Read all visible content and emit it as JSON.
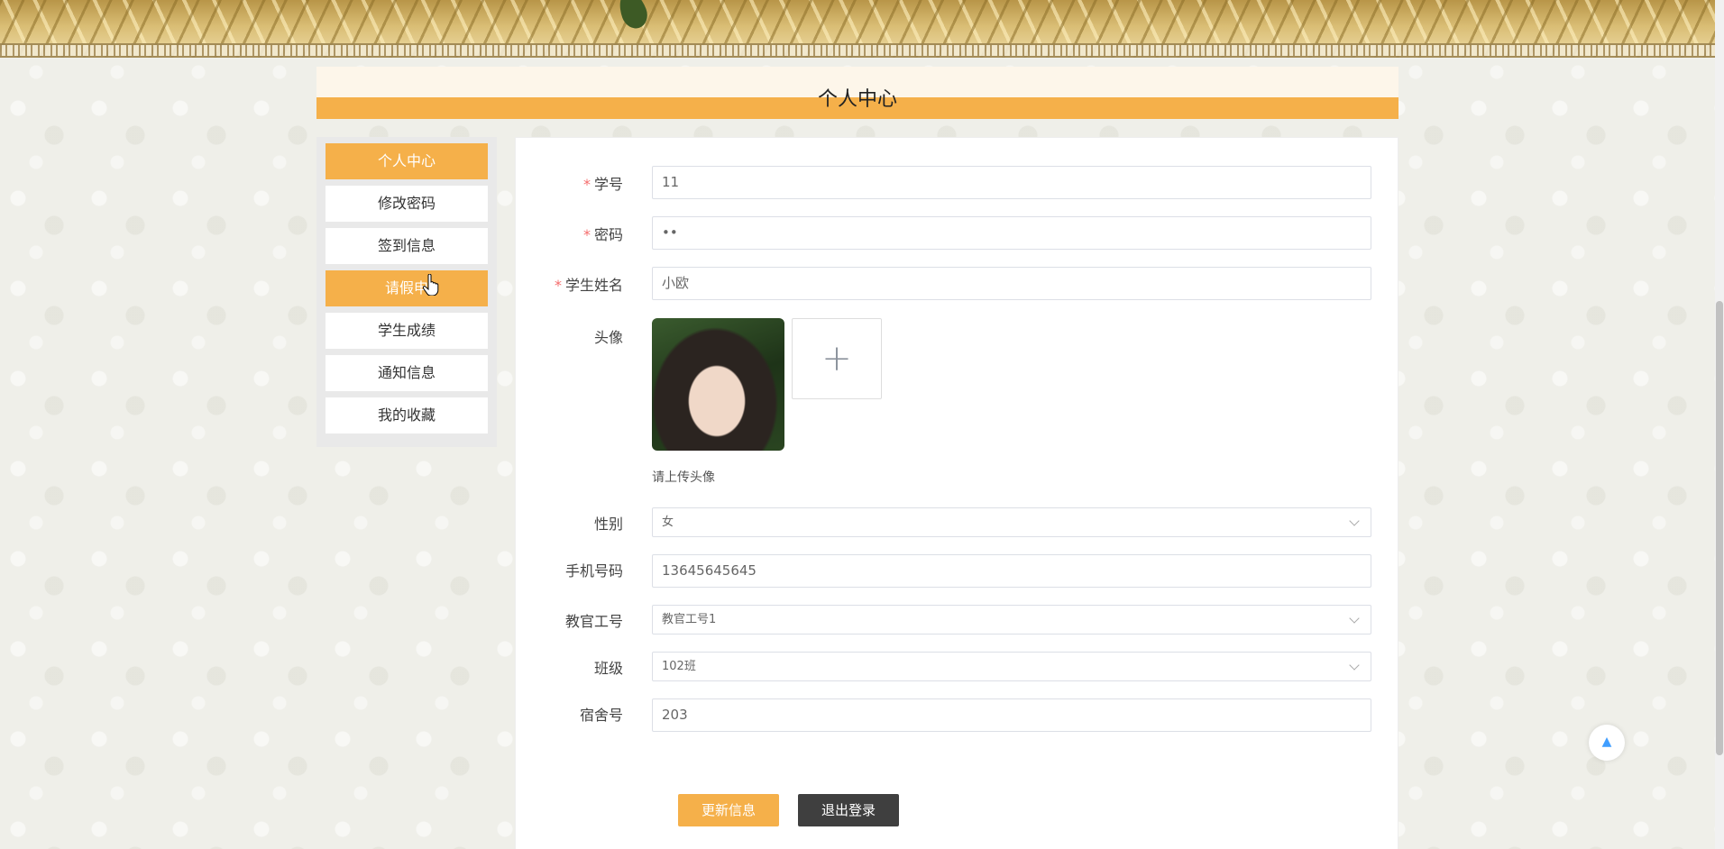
{
  "header": {
    "page_title": "个人中心"
  },
  "sidebar": {
    "items": [
      {
        "label": "个人中心",
        "active": true
      },
      {
        "label": "修改密码",
        "active": false
      },
      {
        "label": "签到信息",
        "active": false
      },
      {
        "label": "请假申",
        "active": true
      },
      {
        "label": "学生成绩",
        "active": false
      },
      {
        "label": "通知信息",
        "active": false
      },
      {
        "label": "我的收藏",
        "active": false
      }
    ]
  },
  "form": {
    "student_id": {
      "label": "学号",
      "required": true,
      "value": "11"
    },
    "password": {
      "label": "密码",
      "required": true,
      "value": "••"
    },
    "student_name": {
      "label": "学生姓名",
      "required": true,
      "value": "小欧"
    },
    "avatar": {
      "label": "头像",
      "hint": "请上传头像",
      "upload_icon": "+"
    },
    "gender": {
      "label": "性别",
      "value": "女"
    },
    "phone": {
      "label": "手机号码",
      "value": "13645645645"
    },
    "instructor_id": {
      "label": "教官工号",
      "value": "教官工号1"
    },
    "class": {
      "label": "班级",
      "value": "102班"
    },
    "dorm": {
      "label": "宿舍号",
      "value": "203"
    }
  },
  "actions": {
    "update_label": "更新信息",
    "logout_label": "退出登录"
  },
  "colors": {
    "accent": "#f5b04a",
    "dark_button": "#3f3f3f",
    "required": "#f56c6c"
  },
  "icons": {
    "back_to_top": "chevron-up-icon",
    "cursor": "hand-pointer-icon"
  }
}
